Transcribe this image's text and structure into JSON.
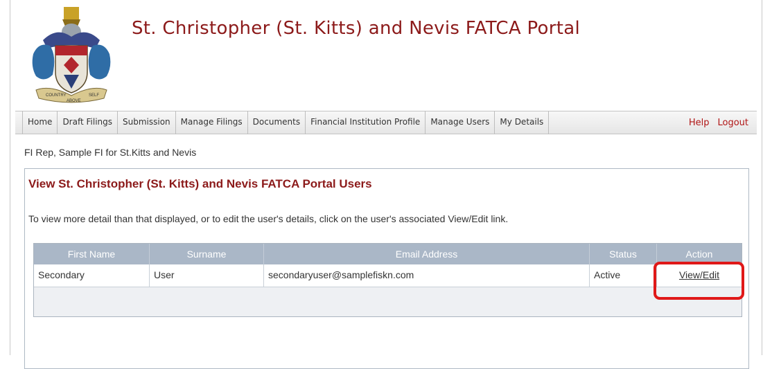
{
  "header": {
    "title": "St. Christopher (St. Kitts) and Nevis FATCA Portal"
  },
  "logo": {
    "motto_left": "COUNTRY",
    "motto_center": "ABOVE",
    "motto_right": "SELF"
  },
  "nav": {
    "items": [
      {
        "label": "Home"
      },
      {
        "label": "Draft Filings"
      },
      {
        "label": "Submission"
      },
      {
        "label": "Manage Filings"
      },
      {
        "label": "Documents"
      },
      {
        "label": "Financial Institution Profile"
      },
      {
        "label": "Manage Users"
      },
      {
        "label": "My Details"
      }
    ],
    "help_label": "Help",
    "logout_label": "Logout"
  },
  "user_context": "FI Rep, Sample FI for St.Kitts and Nevis",
  "panel": {
    "title": "View St. Christopher (St. Kitts) and Nevis FATCA Portal Users",
    "instructions": "To view more detail than that displayed, or to edit the user's details, click on the user's associated View/Edit link."
  },
  "table": {
    "columns": [
      "First Name",
      "Surname",
      "Email Address",
      "Status",
      "Action"
    ],
    "rows": [
      {
        "first_name": "Secondary",
        "surname": "User",
        "email": "secondaryuser@samplefiskn.com",
        "status": "Active",
        "action": "View/Edit"
      }
    ]
  },
  "colors": {
    "title_red": "#8c1a1a",
    "header_bg": "#aab7c7",
    "highlight": "#e01818"
  }
}
